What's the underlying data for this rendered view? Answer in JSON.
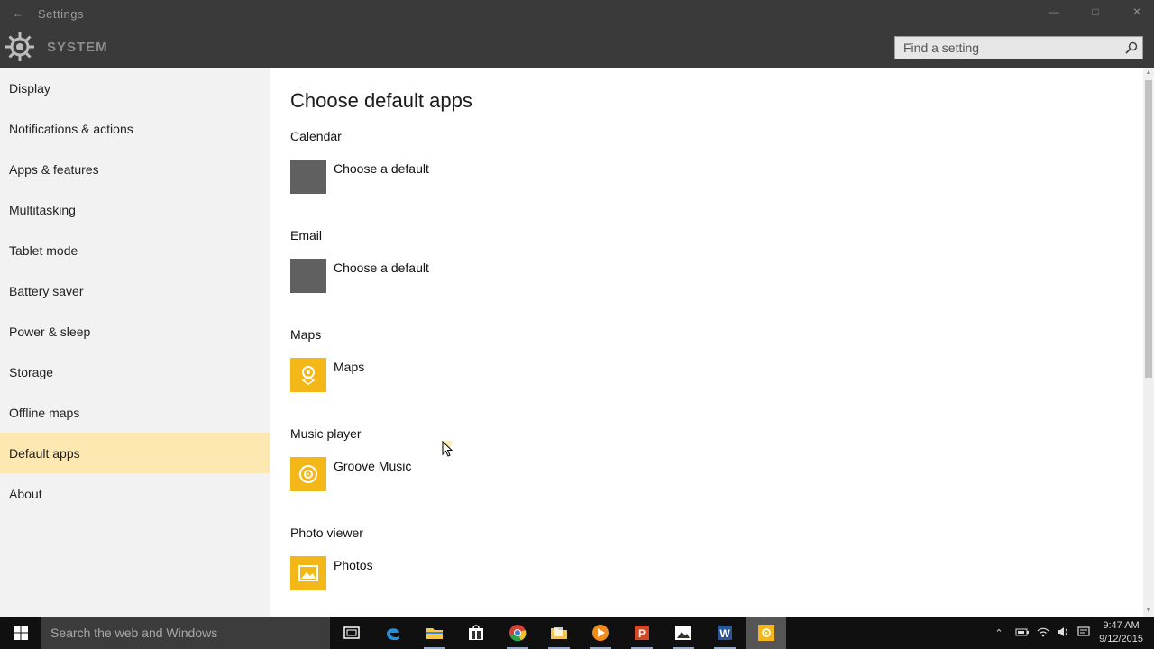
{
  "window": {
    "app_title": "Settings",
    "section_title": "SYSTEM",
    "controls": {
      "minimize": "—",
      "maximize": "□",
      "close": "✕"
    }
  },
  "search": {
    "placeholder": "Find a setting"
  },
  "sidebar": {
    "items": [
      {
        "label": "Display"
      },
      {
        "label": "Notifications & actions"
      },
      {
        "label": "Apps & features"
      },
      {
        "label": "Multitasking"
      },
      {
        "label": "Tablet mode"
      },
      {
        "label": "Battery saver"
      },
      {
        "label": "Power & sleep"
      },
      {
        "label": "Storage"
      },
      {
        "label": "Offline maps"
      },
      {
        "label": "Default apps",
        "active": true
      },
      {
        "label": "About"
      }
    ]
  },
  "main": {
    "title": "Choose default apps",
    "categories": [
      {
        "label": "Calendar",
        "app": "Choose a default",
        "icon": "blank-icon"
      },
      {
        "label": "Email",
        "app": "Choose a default",
        "icon": "blank-icon"
      },
      {
        "label": "Maps",
        "app": "Maps",
        "icon": "maps-icon"
      },
      {
        "label": "Music player",
        "app": "Groove Music",
        "icon": "groove-music-icon"
      },
      {
        "label": "Photo viewer",
        "app": "Photos",
        "icon": "photos-icon"
      }
    ]
  },
  "taskbar": {
    "search_placeholder": "Search the web and Windows",
    "clock": {
      "time": "9:47 AM",
      "date": "9/12/2015"
    }
  },
  "colors": {
    "titlebar": "#3a3a3a",
    "sidebar": "#f2f2f2",
    "active_item": "#fce8b0",
    "accent_yellow": "#f4b718",
    "tile_gray": "#606060",
    "taskbar": "#101010"
  }
}
